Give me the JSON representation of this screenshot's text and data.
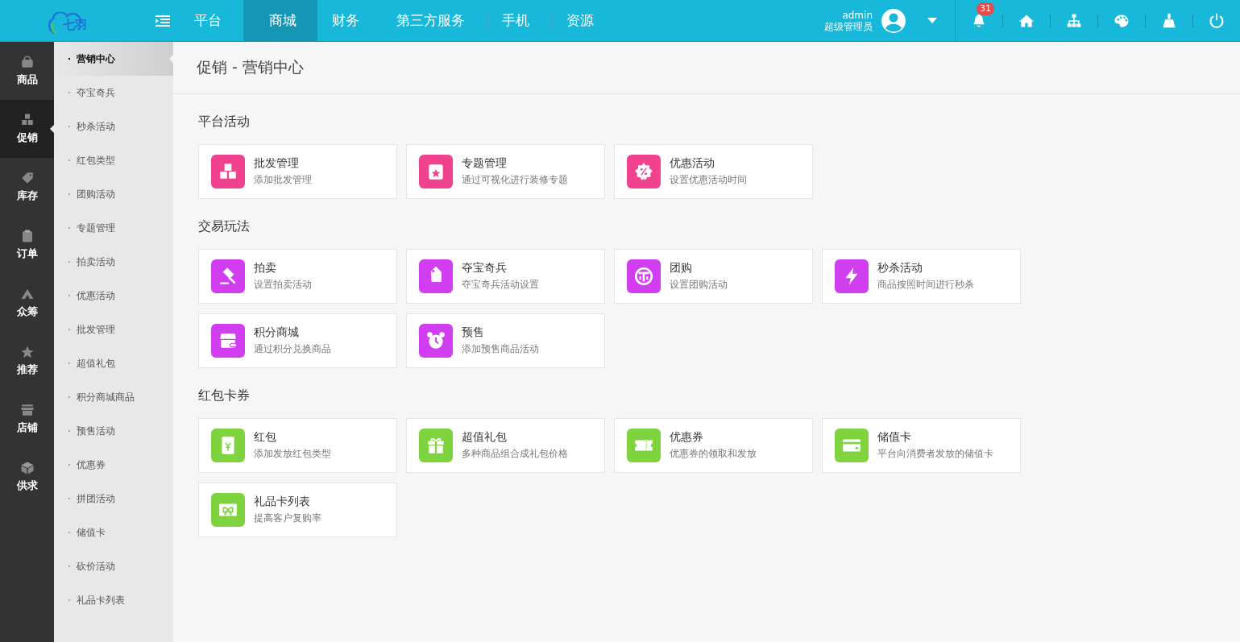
{
  "logo": {
    "text": "七羽"
  },
  "nav": {
    "tabs": [
      {
        "label": "平台",
        "selected": false
      },
      {
        "label": "商城",
        "selected": true
      },
      {
        "label": "财务",
        "selected": false
      },
      {
        "label": "第三方服务",
        "selected": false
      },
      {
        "label": "手机",
        "selected": false
      },
      {
        "label": "资源",
        "selected": false
      }
    ]
  },
  "user": {
    "name": "admin",
    "role": "超级管理员"
  },
  "notifications": {
    "count": "31"
  },
  "rail": {
    "items": [
      {
        "label": "商品",
        "selected": false
      },
      {
        "label": "促销",
        "selected": true
      },
      {
        "label": "库存",
        "selected": false
      },
      {
        "label": "订单",
        "selected": false
      },
      {
        "label": "众筹",
        "selected": false
      },
      {
        "label": "推荐",
        "selected": false
      },
      {
        "label": "店铺",
        "selected": false
      },
      {
        "label": "供求",
        "selected": false
      }
    ]
  },
  "submenu": {
    "items": [
      {
        "label": "营销中心",
        "selected": true
      },
      {
        "label": "夺宝奇兵",
        "selected": false
      },
      {
        "label": "秒杀活动",
        "selected": false
      },
      {
        "label": "红包类型",
        "selected": false
      },
      {
        "label": "团购活动",
        "selected": false
      },
      {
        "label": "专题管理",
        "selected": false
      },
      {
        "label": "拍卖活动",
        "selected": false
      },
      {
        "label": "优惠活动",
        "selected": false
      },
      {
        "label": "批发管理",
        "selected": false
      },
      {
        "label": "超值礼包",
        "selected": false
      },
      {
        "label": "积分商城商品",
        "selected": false
      },
      {
        "label": "预售活动",
        "selected": false
      },
      {
        "label": "优惠券",
        "selected": false
      },
      {
        "label": "拼团活动",
        "selected": false
      },
      {
        "label": "储值卡",
        "selected": false
      },
      {
        "label": "砍价活动",
        "selected": false
      },
      {
        "label": "礼品卡列表",
        "selected": false
      }
    ]
  },
  "page": {
    "title": "促销 - 营销中心"
  },
  "sections": [
    {
      "title": "平台活动",
      "cards": [
        {
          "title": "批发管理",
          "desc": "添加批发管理"
        },
        {
          "title": "专题管理",
          "desc": "通过可视化进行装修专题"
        },
        {
          "title": "优惠活动",
          "desc": "设置优惠活动时间"
        }
      ]
    },
    {
      "title": "交易玩法",
      "cards": [
        {
          "title": "拍卖",
          "desc": "设置拍卖活动"
        },
        {
          "title": "夺宝奇兵",
          "desc": "夺宝奇兵活动设置"
        },
        {
          "title": "团购",
          "desc": "设置团购活动"
        },
        {
          "title": "秒杀活动",
          "desc": "商品按照时间进行秒杀"
        },
        {
          "title": "积分商城",
          "desc": "通过积分兑换商品"
        },
        {
          "title": "预售",
          "desc": "添加预售商品活动"
        }
      ]
    },
    {
      "title": "红包卡券",
      "cards": [
        {
          "title": "红包",
          "desc": "添加发放红包类型"
        },
        {
          "title": "超值礼包",
          "desc": "多种商品组合成礼包价格"
        },
        {
          "title": "优惠券",
          "desc": "优惠券的领取和发放"
        },
        {
          "title": "储值卡",
          "desc": "平台向消费者发放的储值卡"
        },
        {
          "title": "礼品卡列表",
          "desc": "提高客户复购率"
        }
      ]
    }
  ]
}
